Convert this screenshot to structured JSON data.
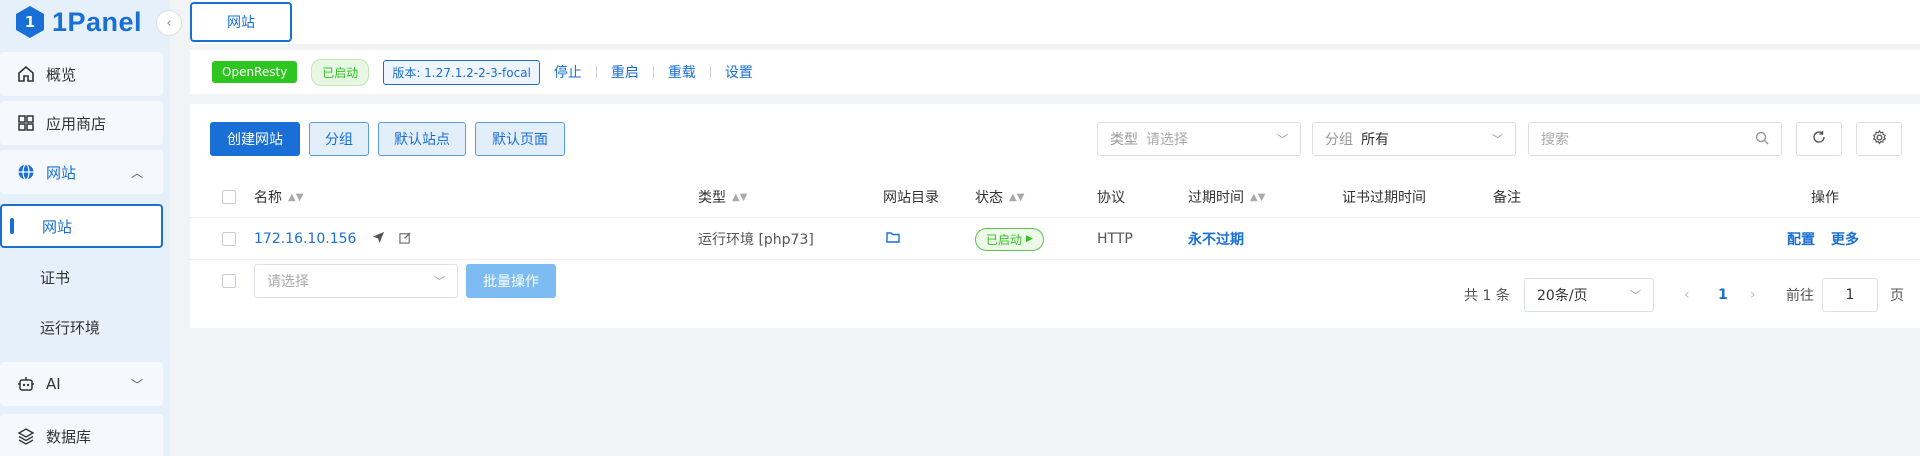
{
  "brand": {
    "logo_text": "1Panel",
    "logo_glyph": "1"
  },
  "sidebar": {
    "items": [
      {
        "label": "概览",
        "icon": "home-icon"
      },
      {
        "label": "应用商店",
        "icon": "grid-icon"
      },
      {
        "label": "网站",
        "icon": "globe-icon",
        "expanded": true
      },
      {
        "label": "AI",
        "icon": "robot-icon"
      },
      {
        "label": "数据库",
        "icon": "layers-icon"
      }
    ],
    "sub_items": [
      {
        "label": "网站",
        "active": true
      },
      {
        "label": "证书"
      },
      {
        "label": "运行环境"
      }
    ]
  },
  "top_tab": {
    "label": "网站"
  },
  "status_bar": {
    "server_name": "OpenResty",
    "running_badge": "已启动",
    "version": "版本: 1.27.1.2-2-3-focal",
    "actions": [
      "停止",
      "重启",
      "重载",
      "设置"
    ]
  },
  "toolbar": {
    "create_label": "创建网站",
    "group_label": "分组",
    "default_site_label": "默认站点",
    "default_page_label": "默认页面",
    "type_filter": {
      "label": "类型",
      "placeholder": "请选择"
    },
    "group_filter": {
      "label": "分组",
      "value": "所有"
    },
    "search_placeholder": "搜索"
  },
  "table": {
    "headers": {
      "name": "名称",
      "type": "类型",
      "dir": "网站目录",
      "status": "状态",
      "protocol": "协议",
      "expire": "过期时间",
      "cert_expire": "证书过期时间",
      "remark": "备注",
      "ops": "操作"
    },
    "rows": [
      {
        "name": "172.16.10.156",
        "type": "运行环境 [php73]",
        "status": "已启动",
        "protocol": "HTTP",
        "expire": "永不过期",
        "op_config": "配置",
        "op_more": "更多"
      }
    ]
  },
  "footer": {
    "batch_placeholder": "请选择",
    "batch_label": "批量操作",
    "total": "共 1 条",
    "page_size": "20条/页",
    "current_page": "1",
    "goto_label": "前往",
    "goto_value": "1",
    "page_unit": "页"
  },
  "colors": {
    "primary": "#1a6fd6",
    "success": "#2ec520"
  }
}
